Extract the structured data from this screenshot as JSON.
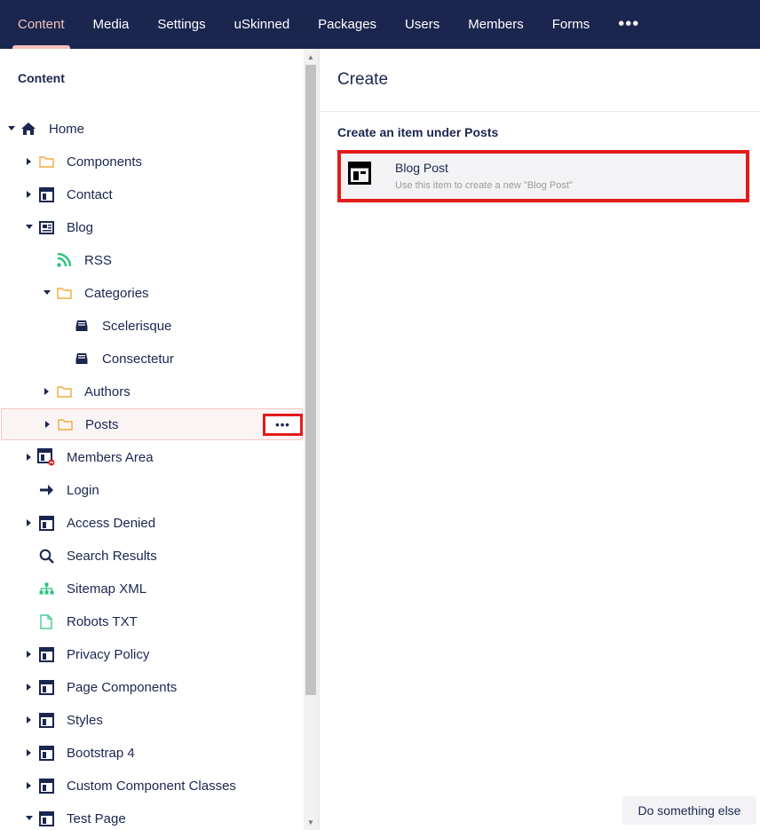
{
  "nav": {
    "items": [
      "Content",
      "Media",
      "Settings",
      "uSkinned",
      "Packages",
      "Users",
      "Members",
      "Forms"
    ],
    "active": "Content",
    "more": "•••"
  },
  "tree": {
    "header": "Content",
    "items": [
      {
        "label": "Home",
        "icon": "home-icon",
        "caret": "down",
        "level": 0
      },
      {
        "label": "Components",
        "icon": "folder-icon",
        "caret": "right",
        "level": 1
      },
      {
        "label": "Contact",
        "icon": "layout-icon",
        "caret": "right",
        "level": 1
      },
      {
        "label": "Blog",
        "icon": "newspaper-icon",
        "caret": "down",
        "level": 1
      },
      {
        "label": "RSS",
        "icon": "rss-icon",
        "caret": "none",
        "level": 2
      },
      {
        "label": "Categories",
        "icon": "folder-icon",
        "caret": "down",
        "level": 2
      },
      {
        "label": "Scelerisque",
        "icon": "inbox-icon",
        "caret": "none",
        "level": 3
      },
      {
        "label": "Consectetur",
        "icon": "inbox-icon",
        "caret": "none",
        "level": 3
      },
      {
        "label": "Authors",
        "icon": "folder-icon",
        "caret": "right",
        "level": 2
      },
      {
        "label": "Posts",
        "icon": "folder-icon",
        "caret": "right",
        "level": 2,
        "selected": true
      },
      {
        "label": "Members Area",
        "icon": "protected-page-icon",
        "caret": "right",
        "level": 1
      },
      {
        "label": "Login",
        "icon": "arrow-right-icon",
        "caret": "none",
        "level": 1
      },
      {
        "label": "Access Denied",
        "icon": "layout-icon",
        "caret": "right",
        "level": 1
      },
      {
        "label": "Search Results",
        "icon": "search-icon",
        "caret": "none",
        "level": 1
      },
      {
        "label": "Sitemap XML",
        "icon": "sitemap-icon",
        "caret": "none",
        "level": 1
      },
      {
        "label": "Robots TXT",
        "icon": "document-icon",
        "caret": "none",
        "level": 1
      },
      {
        "label": "Privacy Policy",
        "icon": "layout-icon",
        "caret": "right",
        "level": 1
      },
      {
        "label": "Page Components",
        "icon": "layout-icon",
        "caret": "right",
        "level": 1
      },
      {
        "label": "Styles",
        "icon": "layout-icon",
        "caret": "right",
        "level": 1
      },
      {
        "label": "Bootstrap 4",
        "icon": "layout-icon",
        "caret": "right",
        "level": 1
      },
      {
        "label": "Custom Component Classes",
        "icon": "layout-icon",
        "caret": "right",
        "level": 1
      },
      {
        "label": "Test Page",
        "icon": "layout-icon",
        "caret": "down",
        "level": 1
      }
    ],
    "actions_label": "•••"
  },
  "create": {
    "title": "Create",
    "subtitle": "Create an item under Posts",
    "doctype": {
      "name": "Blog Post",
      "description": "Use this item to create a new \"Blog Post\"",
      "icon": "layout-icon"
    },
    "other_button": "Do something else"
  },
  "colors": {
    "nav_bg": "#1b264f",
    "nav_active": "#f5c1bc",
    "folder": "#f0ac3b",
    "green": "#2bc37c",
    "highlight": "#e31b1b"
  }
}
